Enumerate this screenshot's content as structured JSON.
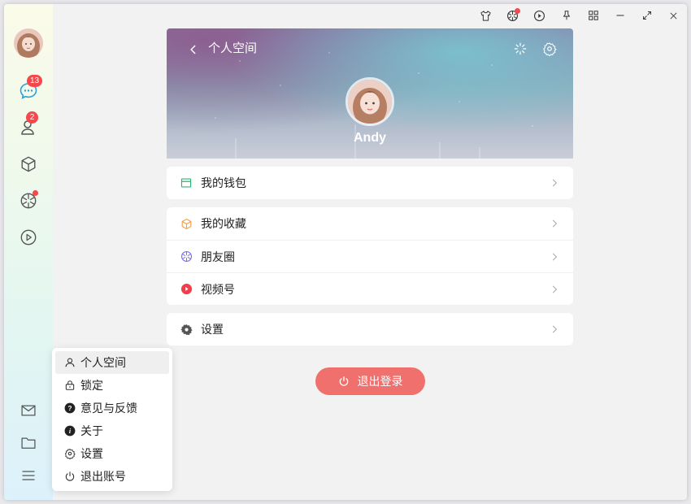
{
  "badges": {
    "messages": "13",
    "contacts": "2"
  },
  "profile": {
    "header_title": "个人空间",
    "username": "Andy"
  },
  "menu": {
    "wallet": "我的钱包",
    "favorites": "我的收藏",
    "moments": "朋友圈",
    "channels": "视频号",
    "settings": "设置"
  },
  "logout_button": "退出登录",
  "popup": {
    "items": [
      "个人空间",
      "锁定",
      "意见与反馈",
      "关于",
      "设置",
      "退出账号"
    ]
  },
  "colors": {
    "accent_red": "#f0706d",
    "badge": "#f5474c",
    "wallet_green": "#2bb673",
    "favorites_orange": "#f5a040",
    "moments_purple": "#7b6cf0",
    "channels_red": "#f23d4d"
  }
}
